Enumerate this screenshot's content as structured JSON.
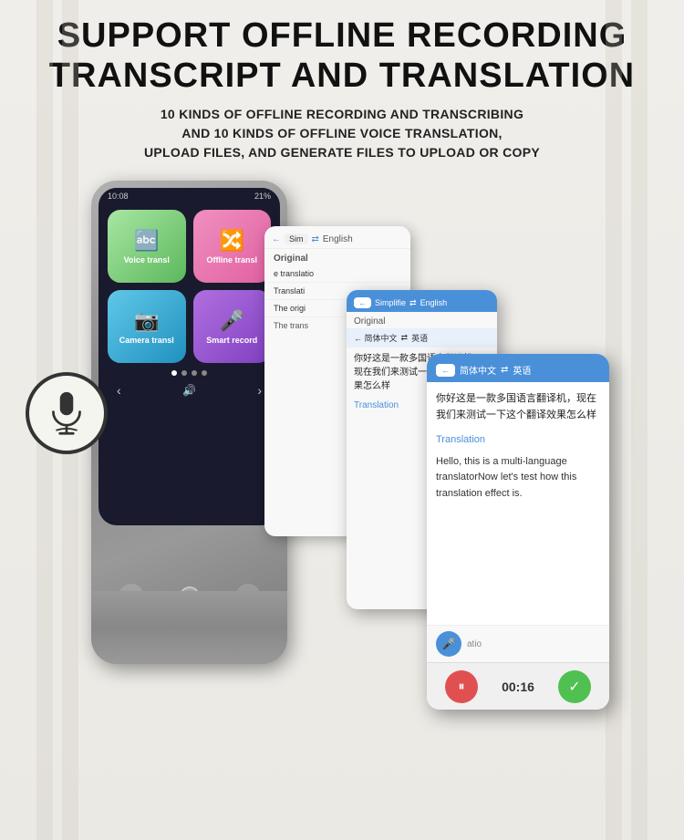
{
  "page": {
    "background": "#f0eeea"
  },
  "header": {
    "main_title": "SUPPORT OFFLINE RECORDING\nTRANSCRIPT AND TRANSLATION",
    "main_title_line1": "SUPPORT OFFLINE RECORDING",
    "main_title_line2": "TRANSCRIPT AND TRANSLATION",
    "sub_title_line1": "10 KINDS OF OFFLINE RECORDING AND TRANSCRIBING",
    "sub_title_line2": "AND 10 KINDS OF OFFLINE VOICE TRANSLATION,",
    "sub_title_line3": "UPLOAD FILES, AND GENERATE FILES TO UPLOAD OR COPY"
  },
  "device": {
    "status_time": "10:08",
    "status_battery": "21%",
    "apps": [
      {
        "label": "Voice transl",
        "icon": "🔤"
      },
      {
        "label": "Offline transl",
        "icon": "🔀"
      },
      {
        "label": "Camera transl",
        "icon": "📷"
      },
      {
        "label": "Smart record",
        "icon": "🎤"
      }
    ]
  },
  "screenshot1": {
    "back_arrow": "←",
    "lang_from": "Sim",
    "arrow": "⇄",
    "lang_to": "English",
    "original_label": "Original",
    "translation_row": "e translatio",
    "translation_label": "Translati",
    "original_text": "The origi",
    "translated_text": "The tran"
  },
  "screenshot2": {
    "back_label": "←",
    "simplified_label": "Simplifie",
    "arrow": "⇄",
    "english_label": "English",
    "original_label": "Original",
    "lang_from": "简体中文",
    "arrow2": "⇄",
    "lang_to": "英语",
    "chinese_text": "你好这是一款多国语言翻译机，现在我们来测试一下这个翻译效果怎么样",
    "translation_label": "Translation"
  },
  "screenshot3": {
    "back_label": "←",
    "simplified_label": "简体中文",
    "arrow": "⇄",
    "english_label": "英语",
    "chinese_text": "你好这是一款多国语言翻译机，现在我们来测试一下这个翻译效果怎么样",
    "translation_label": "Translation",
    "english_text": "Hello, this is a multi-language translatorNow let's test how this translation effect is.",
    "timer": "00:16",
    "atio_text": "atio"
  },
  "mic_icon": {
    "label": "microphone"
  }
}
